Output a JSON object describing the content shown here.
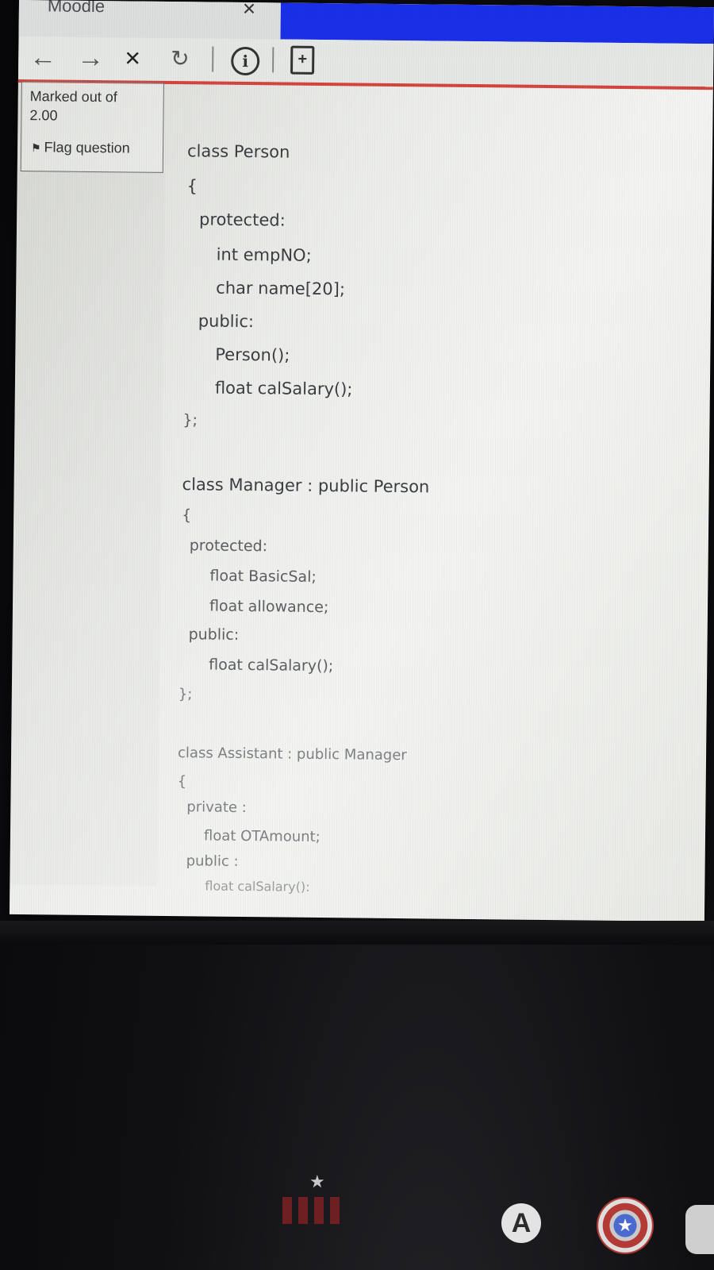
{
  "browser": {
    "tab_title": "Moodle",
    "tab_close": "×",
    "nav": {
      "back": "←",
      "forward": "→",
      "stop": "×",
      "refresh": "↻",
      "info": "i",
      "page_action": "+"
    }
  },
  "question_info": {
    "marked_label": "Marked out of",
    "marked_value": "2.00",
    "flag_label": "Flag question"
  },
  "code_lines": [
    "class Person",
    "{",
    "protected:",
    "int empNO;",
    "char name[20];",
    "public:",
    "Person();",
    "float calSalary();",
    "};",
    "class Manager : public Person",
    "{",
    "protected:",
    "float BasicSal;",
    "float allowance;",
    "public:",
    "float calSalary();",
    "};",
    "class Assistant : public Manager",
    "{",
    "private :",
    "float OTAmount;",
    "public :",
    "float calSalary():"
  ],
  "colors": {
    "accent_blue": "#1a2fe8",
    "accent_red": "#d4453e"
  }
}
